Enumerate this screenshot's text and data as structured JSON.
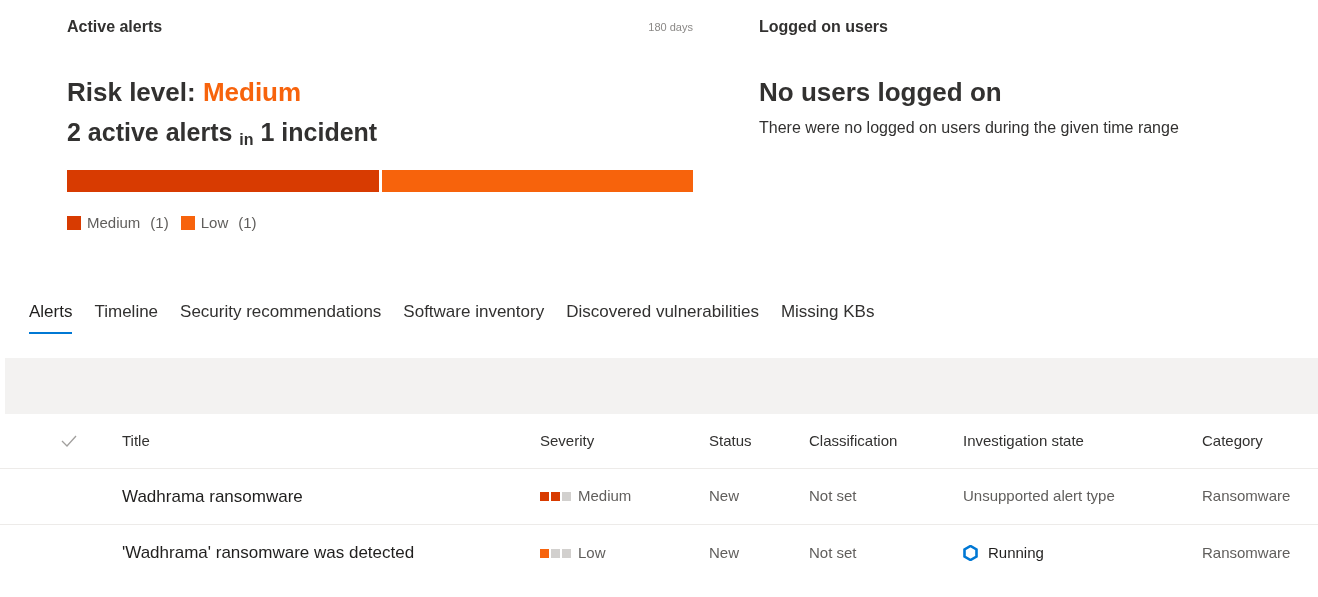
{
  "alerts_panel": {
    "title": "Active alerts",
    "period": "180 days",
    "risk_label": "Risk level:",
    "risk_value": "Medium",
    "summary": "2 active alerts $_{in}$ 1 incident",
    "bar": [
      {
        "color": "#d83b01"
      },
      {
        "color": "#f7630c"
      }
    ],
    "legend": [
      {
        "label": "Medium",
        "count": "(1)",
        "color": "#d83b01"
      },
      {
        "label": "Low",
        "count": "(1)",
        "color": "#f7630c"
      }
    ]
  },
  "users_panel": {
    "title": "Logged on users",
    "heading": "No users logged on",
    "message": "There were no logged on users during the given time range"
  },
  "tabs": [
    {
      "label": "Alerts",
      "selected": true
    },
    {
      "label": "Timeline",
      "selected": false
    },
    {
      "label": "Security recommendations",
      "selected": false
    },
    {
      "label": "Software inventory",
      "selected": false
    },
    {
      "label": "Discovered vulnerabilities",
      "selected": false
    },
    {
      "label": "Missing KBs",
      "selected": false
    }
  ],
  "table": {
    "columns": [
      "Title",
      "Severity",
      "Status",
      "Classification",
      "Investigation state",
      "Category"
    ],
    "rows": [
      {
        "title": "Wadhrama ransomware",
        "severity": {
          "label": "Medium",
          "kind": "medium"
        },
        "status": "New",
        "classification": "Not set",
        "investigation": "Unsupported alert type",
        "running": false,
        "category": "Ransomware"
      },
      {
        "title": "'Wadhrama' ransomware was detected",
        "severity": {
          "label": "Low",
          "kind": "low"
        },
        "status": "New",
        "classification": "Not set",
        "investigation": "Running",
        "running": true,
        "category": "Ransomware"
      }
    ]
  }
}
